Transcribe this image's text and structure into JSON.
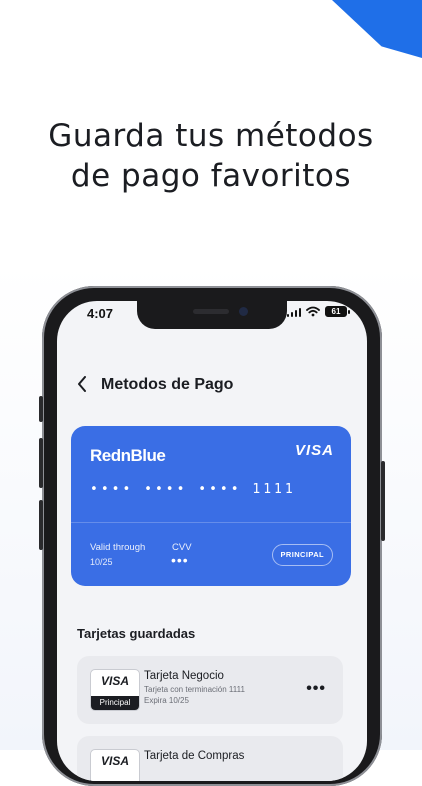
{
  "headline": {
    "line1": "Guarda tus métodos",
    "line2": "de pago favoritos"
  },
  "status": {
    "time": "4:07",
    "battery": "61"
  },
  "nav": {
    "title": "Metodos de Pago"
  },
  "card": {
    "brand": "RednBlue",
    "network": "VISA",
    "number": "•••• •••• •••• 1111",
    "valid_label": "Valid through",
    "valid_value": "10/25",
    "cvv_label": "CVV",
    "cvv_value": "•••",
    "badge": "PRINCIPAL",
    "color": "#3a6ee5"
  },
  "saved": {
    "title": "Tarjetas guardadas",
    "items": [
      {
        "logo": "VISA",
        "badge": "Principal",
        "name": "Tarjeta Negocio",
        "subtitle": "Tarjeta con terminación 1111",
        "expiry": "Expira 10/25"
      },
      {
        "logo": "VISA",
        "name": "Tarjeta de Compras"
      }
    ]
  },
  "colors": {
    "accent": "#1f6fe8",
    "text": "#1b1d22"
  }
}
